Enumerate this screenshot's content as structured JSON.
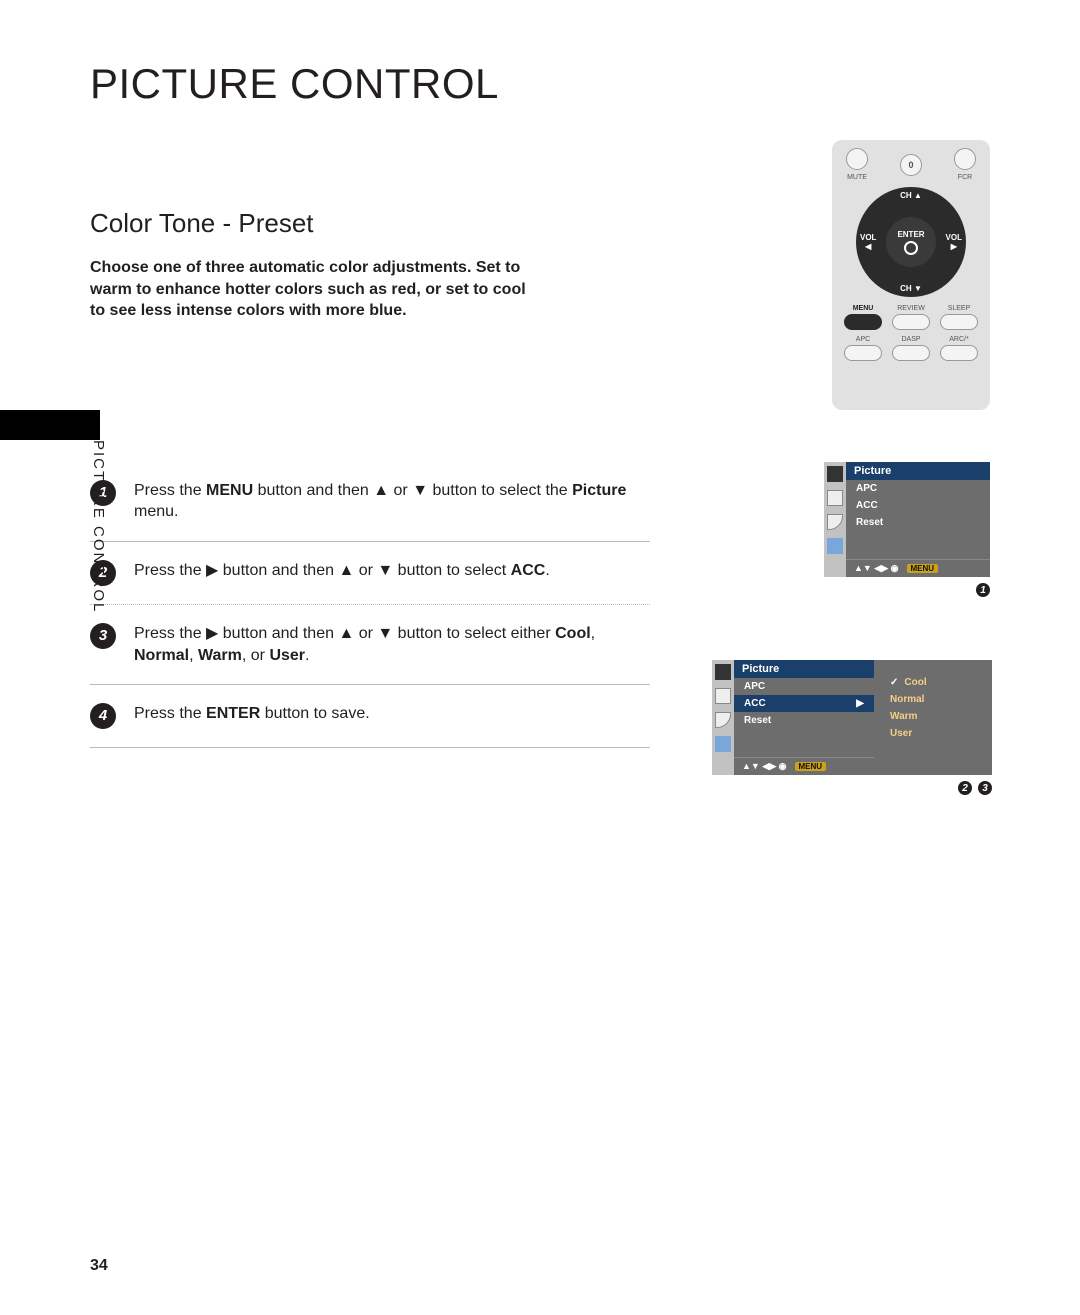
{
  "title": "PICTURE CONTROL",
  "side_label": "PICTURE CONTROL",
  "subtitle": "Color Tone - Preset",
  "intro": "Choose one of three automatic color adjustments. Set to warm to enhance hotter colors such as red, or set to cool to see less intense colors with more blue.",
  "remote": {
    "zero": "0",
    "mute": "MUTE",
    "fcr": "FCR",
    "ch_up": "CH",
    "ch_down": "CH",
    "vol_l": "VOL",
    "vol_r": "VOL",
    "enter": "ENTER",
    "row1": {
      "menu": "MENU",
      "review": "REVIEW",
      "sleep": "SLEEP"
    },
    "row2": {
      "apc": "APC",
      "dasp": "DASP",
      "arc": "ARC/*"
    }
  },
  "steps": {
    "s1": {
      "num": "1",
      "pre": "Press the ",
      "b1": "MENU",
      "mid": " button and then ▲ or ▼ button to select the ",
      "b2": "Picture",
      "post": " menu."
    },
    "s2": {
      "num": "2",
      "pre": "Press the ▶ button and then ▲ or ▼ button to select ",
      "b1": "ACC",
      "post": "."
    },
    "s3": {
      "num": "3",
      "pre": "Press the ▶ button and then ▲ or ▼ button to select either ",
      "b1": "Cool",
      "c1": ", ",
      "b2": "Normal",
      "c2": ", ",
      "b3": "Warm",
      "c3": ", or ",
      "b4": "User",
      "post": "."
    },
    "s4": {
      "num": "4",
      "pre": "Press the ",
      "b1": "ENTER",
      "post": " button to save."
    }
  },
  "osd": {
    "picture": "Picture",
    "apc": "APC",
    "acc": "ACC",
    "reset": "Reset",
    "menu": "MENU",
    "nav": "▲▼  ◀▶  ◉",
    "options": {
      "cool": "Cool",
      "normal": "Normal",
      "warm": "Warm",
      "user": "User"
    },
    "check": "✓",
    "arrow": "▶"
  },
  "badges": {
    "b1": "1",
    "b2": "2",
    "b3": "3"
  },
  "page_num": "34"
}
